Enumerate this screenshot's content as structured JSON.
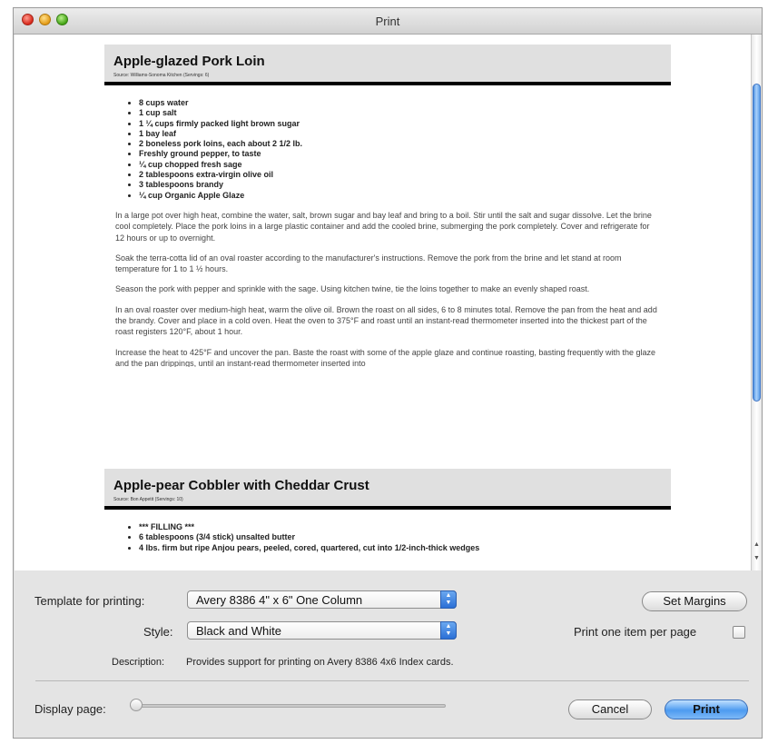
{
  "window": {
    "title": "Print"
  },
  "preview": {
    "recipes": [
      {
        "title": "Apple-glazed Pork Loin",
        "source": "Source: Williams-Sonoma Kitchen (Servings: 6)",
        "ingredients": [
          "8 cups water",
          "1 cup salt",
          "1 ¼ cups firmly packed light brown sugar",
          "1 bay leaf",
          "2 boneless pork loins, each about 2 1/2 lb.",
          "Freshly ground pepper, to taste",
          "¼ cup chopped fresh sage",
          "2 tablespoons extra-virgin olive oil",
          "3 tablespoons brandy",
          "¼ cup Organic Apple Glaze"
        ],
        "paragraphs": [
          "In a large pot over high heat, combine the water, salt, brown sugar and bay leaf and bring to a boil. Stir until the salt and sugar dissolve. Let the brine cool completely. Place the pork loins in a large plastic container and add the cooled brine, submerging the pork completely. Cover and refrigerate for 12 hours or up to overnight.",
          "Soak the terra-cotta lid of an oval roaster according to the manufacturer's instructions. Remove the pork from the brine and let stand at room temperature for 1 to 1 ½ hours.",
          "Season the pork with pepper and sprinkle with the sage. Using kitchen twine, tie the loins together to make an evenly shaped roast.",
          "In an oval roaster over medium-high heat, warm the olive oil. Brown the roast on all sides, 6 to 8 minutes total. Remove the pan from the heat and add the brandy. Cover and place in a cold oven. Heat the oven to 375°F and roast until an instant-read thermometer inserted into the thickest part of the roast registers 120°F, about 1 hour.",
          "Increase the heat to 425°F and uncover the pan. Baste the roast with some of the apple glaze and continue roasting, basting frequently with the glaze and the pan drippings, until an instant-read thermometer inserted into"
        ]
      },
      {
        "title": "Apple-pear Cobbler with Cheddar Crust",
        "source": "Source: Bon Appetit (Servings: 10)",
        "ingredients": [
          "*** FILLING ***",
          "6 tablespoons (3/4 stick) unsalted butter",
          "4 lbs. firm but ripe Anjou pears, peeled, cored, quartered, cut into 1/2-inch-thick wedges"
        ]
      }
    ]
  },
  "controls": {
    "template_label": "Template for printing:",
    "template_value": "Avery 8386 4\" x 6\" One Column",
    "style_label": "Style:",
    "style_value": "Black and White",
    "description_label": "Description:",
    "description_text": "Provides support for printing on Avery 8386 4x6 Index cards.",
    "set_margins": "Set Margins",
    "one_per_page_label": "Print one item per page",
    "one_per_page_checked": false,
    "display_page_label": "Display page:",
    "display_page_position": 0,
    "cancel": "Cancel",
    "print": "Print"
  },
  "colors": {
    "accent": "#4d9bf0",
    "close": "#d8271a",
    "minimize": "#e39a15",
    "zoom": "#43a314"
  }
}
